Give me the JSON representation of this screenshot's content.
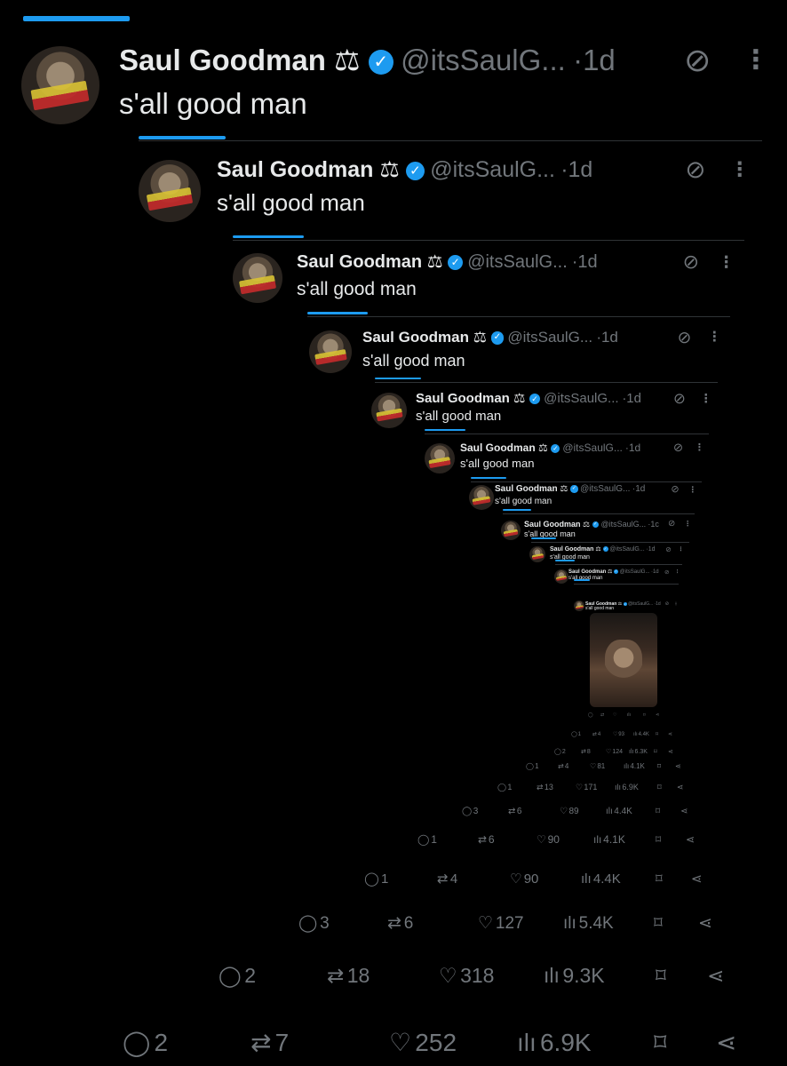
{
  "tweets": [
    {
      "name": "Saul Goodman",
      "scales": "⚖",
      "badge": "✓",
      "handle": "@itsSaulG...",
      "time": "·1d",
      "text": "s'all good man",
      "grok_icon": "slash-circle-icon",
      "more_icon": "more-vertical-icon"
    },
    {
      "name": "Saul Goodman",
      "scales": "⚖",
      "badge": "✓",
      "handle": "@itsSaulG...",
      "time": "·1d",
      "text": "s'all good man",
      "grok_icon": "slash-circle-icon",
      "more_icon": "more-vertical-icon"
    },
    {
      "name": "Saul Goodman",
      "scales": "⚖",
      "badge": "✓",
      "handle": "@itsSaulG...",
      "time": "·1d",
      "text": "s'all good man",
      "grok_icon": "slash-circle-icon",
      "more_icon": "more-vertical-icon"
    },
    {
      "name": "Saul Goodman",
      "scales": "⚖",
      "badge": "✓",
      "handle": "@itsSaulG...",
      "time": "·1d",
      "text": "s'all good man",
      "grok_icon": "slash-circle-icon",
      "more_icon": "more-vertical-icon"
    },
    {
      "name": "Saul Goodman",
      "scales": "⚖",
      "badge": "✓",
      "handle": "@itsSaulG...",
      "time": "·1d",
      "text": "s'all good man",
      "grok_icon": "slash-circle-icon",
      "more_icon": "more-vertical-icon"
    },
    {
      "name": "Saul Goodman",
      "scales": "⚖",
      "badge": "✓",
      "handle": "@itsSaulG...",
      "time": "·1d",
      "text": "s'all good man",
      "grok_icon": "slash-circle-icon",
      "more_icon": "more-vertical-icon"
    },
    {
      "name": "Saul Goodman",
      "scales": "⚖",
      "badge": "✓",
      "handle": "@itsSaulG...",
      "time": "·1d",
      "text": "s'all good man",
      "grok_icon": "slash-circle-icon",
      "more_icon": "more-vertical-icon"
    },
    {
      "name": "Saul Goodman",
      "scales": "⚖",
      "badge": "✓",
      "handle": "@itsSaulG...",
      "time": "·1c",
      "text": "s'all good man",
      "grok_icon": "slash-circle-icon",
      "more_icon": "more-vertical-icon"
    },
    {
      "name": "Saul Goodman",
      "scales": "⚖",
      "badge": "✓",
      "handle": "@itsSaulG...",
      "time": "·1d",
      "text": "s'all good man",
      "grok_icon": "slash-circle-icon",
      "more_icon": "more-vertical-icon"
    },
    {
      "name": "Saul Goodman",
      "scales": "⚖",
      "badge": "✓",
      "handle": "@itsSaulG...",
      "time": "·1d",
      "text": "s'all good man",
      "grok_icon": "slash-circle-icon",
      "more_icon": "more-vertical-icon"
    },
    {
      "name": "Saul Goodman",
      "scales": "⚖",
      "badge": "✓",
      "handle": "@itsSaulG...",
      "time": "·1d",
      "text": "s'all good man",
      "grok_icon": "slash-circle-icon",
      "more_icon": "more-vertical-icon"
    }
  ],
  "action_rows": [
    {
      "reply": "",
      "retweet": "",
      "like": "",
      "views": ""
    },
    {
      "reply": "1",
      "retweet": "4",
      "like": "93",
      "views": "4.4K"
    },
    {
      "reply": "2",
      "retweet": "8",
      "like": "124",
      "views": "6.3K"
    },
    {
      "reply": "1",
      "retweet": "4",
      "like": "81",
      "views": "4.1K"
    },
    {
      "reply": "1",
      "retweet": "13",
      "like": "171",
      "views": "6.9K"
    },
    {
      "reply": "3",
      "retweet": "6",
      "like": "89",
      "views": "4.4K"
    },
    {
      "reply": "1",
      "retweet": "6",
      "like": "90",
      "views": "4.1K"
    },
    {
      "reply": "1",
      "retweet": "4",
      "like": "90",
      "views": "4.4K"
    },
    {
      "reply": "3",
      "retweet": "6",
      "like": "127",
      "views": "5.4K"
    },
    {
      "reply": "2",
      "retweet": "18",
      "like": "318",
      "views": "9.3K"
    },
    {
      "reply": "2",
      "retweet": "7",
      "like": "252",
      "views": "6.9K"
    }
  ],
  "icons": {
    "reply": "💬",
    "retweet": "⇄",
    "like": "♡",
    "views": "📊",
    "bookmark": "🔖",
    "share": "⋖",
    "avatar": "better-call-saul-avatar",
    "verified": "verified-badge-icon",
    "scales": "scales-icon"
  },
  "colors": {
    "accent": "#1d9bf0",
    "background": "#000000",
    "text": "#e7e9ea",
    "muted": "#71767b",
    "divider": "#2f3336"
  }
}
